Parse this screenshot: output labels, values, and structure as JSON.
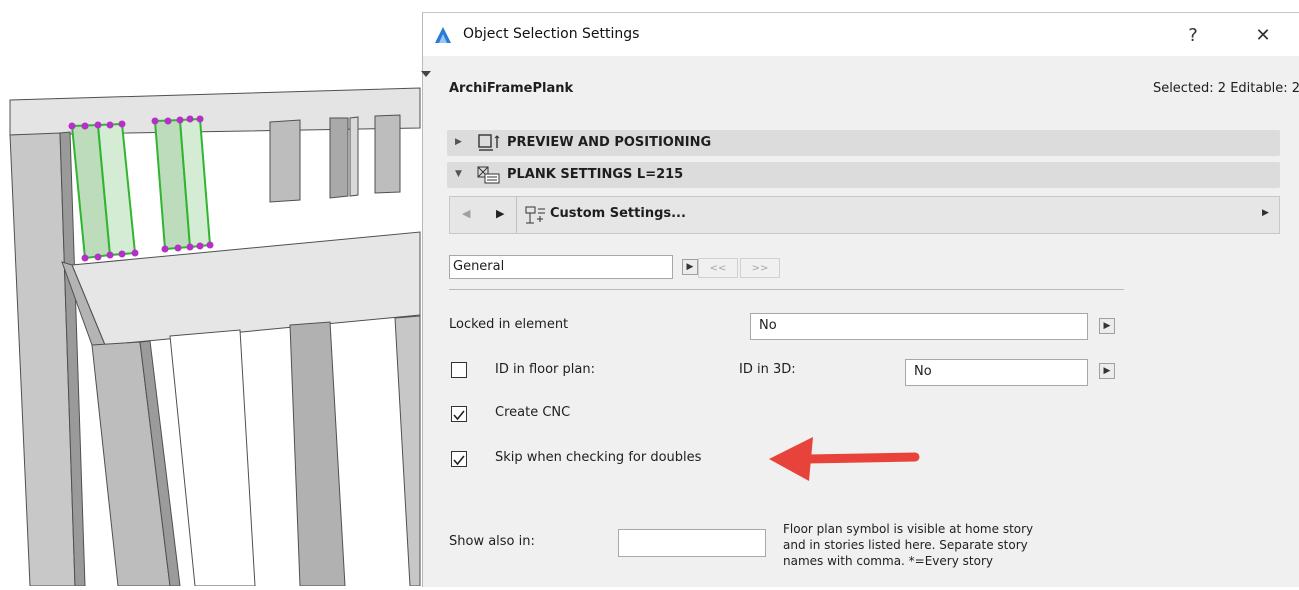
{
  "dialog": {
    "title": "Object Selection Settings",
    "help_glyph": "?",
    "close_glyph": "✕",
    "object_name": "ArchiFramePlank",
    "selection_status": "Selected: 2 Editable: 2"
  },
  "panels": {
    "preview": {
      "label": "PREVIEW AND POSITIONING",
      "expanded": false
    },
    "plank": {
      "label": "PLANK SETTINGS L=215",
      "expanded": true
    }
  },
  "toolbar": {
    "prev_glyph": "◀",
    "next_glyph": "▶",
    "custom_settings_label": "Custom Settings...",
    "menu_glyph": "▶"
  },
  "page_select": {
    "value": "General",
    "arrow_glyph": "▶",
    "prev_page_label": "<<",
    "next_page_label": ">>"
  },
  "form": {
    "locked_label": "Locked in element",
    "locked_value": "No",
    "id_floor_plan_label": "ID in floor plan:",
    "id_floor_plan_checked": false,
    "id_3d_label": "ID in 3D:",
    "id_3d_value": "No",
    "create_cnc_label": "Create CNC",
    "create_cnc_checked": true,
    "skip_doubles_label": "Skip when checking for doubles",
    "skip_doubles_checked": true,
    "show_also_label": "Show also in:",
    "show_also_value": "",
    "show_also_help_1": "Floor plan symbol is visible at home story",
    "show_also_help_2": "and in stories listed here. Separate story",
    "show_also_help_3": "names with comma. *=Every story"
  },
  "colors": {
    "annotation_arrow": "#e8433a",
    "selection_highlight": "#2fb52f",
    "selection_handles": "#b62fc7",
    "app_icon": "#2a7ad8"
  }
}
